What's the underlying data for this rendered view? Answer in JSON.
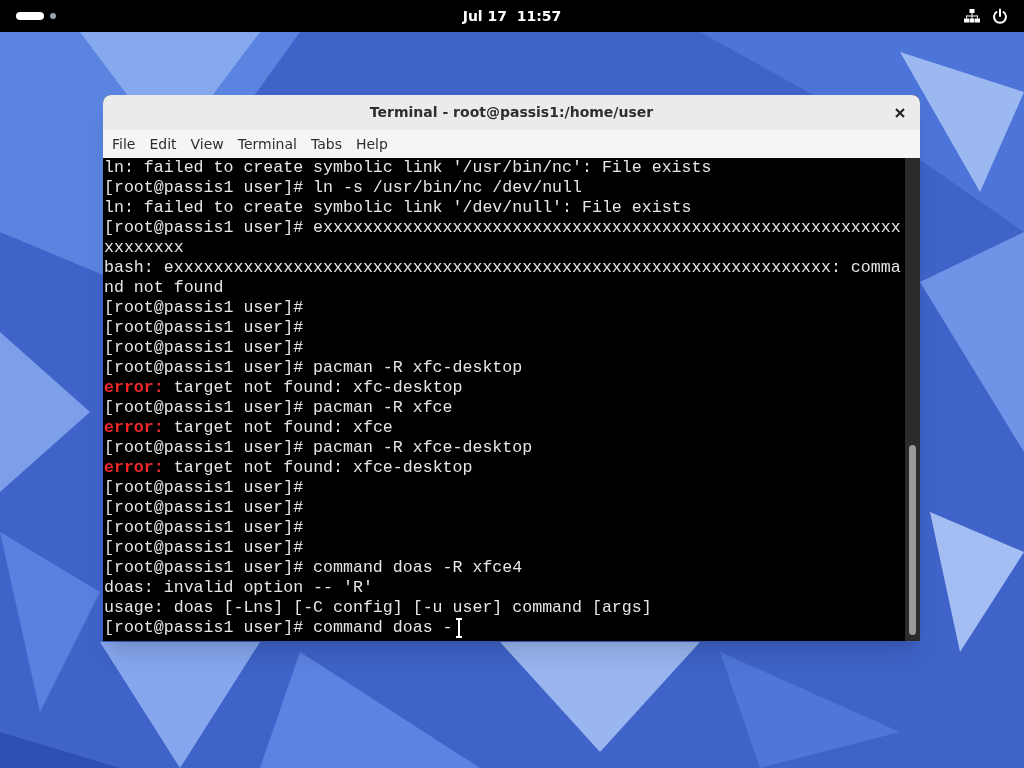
{
  "top_bar": {
    "clock": "Jul 17  11:57"
  },
  "window": {
    "title": "Terminal - root@passis1:/home/user"
  },
  "menu": [
    "File",
    "Edit",
    "View",
    "Terminal",
    "Tabs",
    "Help"
  ],
  "terminal": {
    "lines": [
      {
        "kind": "plain",
        "text": "ln: failed to create symbolic link '/usr/bin/nc': File exists"
      },
      {
        "kind": "plain",
        "text": "[root@passis1 user]# ln -s /usr/bin/nc /dev/null"
      },
      {
        "kind": "plain",
        "text": "ln: failed to create symbolic link '/dev/null': File exists"
      },
      {
        "kind": "plain",
        "text": "[root@passis1 user]# exxxxxxxxxxxxxxxxxxxxxxxxxxxxxxxxxxxxxxxxxxxxxxxxxxxxxxxxxx"
      },
      {
        "kind": "plain",
        "text": "xxxxxxxx"
      },
      {
        "kind": "plain",
        "text": "bash: exxxxxxxxxxxxxxxxxxxxxxxxxxxxxxxxxxxxxxxxxxxxxxxxxxxxxxxxxxxxxxxxxx: comma"
      },
      {
        "kind": "plain",
        "text": "nd not found"
      },
      {
        "kind": "plain",
        "text": "[root@passis1 user]#"
      },
      {
        "kind": "plain",
        "text": "[root@passis1 user]#"
      },
      {
        "kind": "plain",
        "text": "[root@passis1 user]#"
      },
      {
        "kind": "plain",
        "text": "[root@passis1 user]# pacman -R xfc-desktop"
      },
      {
        "kind": "error",
        "label": "error:",
        "text": "target not found: xfc-desktop"
      },
      {
        "kind": "plain",
        "text": "[root@passis1 user]# pacman -R xfce"
      },
      {
        "kind": "error",
        "label": "error:",
        "text": "target not found: xfce"
      },
      {
        "kind": "plain",
        "text": "[root@passis1 user]# pacman -R xfce-desktop"
      },
      {
        "kind": "error",
        "label": "error:",
        "text": "target not found: xfce-desktop"
      },
      {
        "kind": "plain",
        "text": "[root@passis1 user]#"
      },
      {
        "kind": "plain",
        "text": "[root@passis1 user]#"
      },
      {
        "kind": "plain",
        "text": "[root@passis1 user]#"
      },
      {
        "kind": "plain",
        "text": "[root@passis1 user]#"
      },
      {
        "kind": "plain",
        "text": "[root@passis1 user]# command doas -R xfce4"
      },
      {
        "kind": "plain",
        "text": "doas: invalid option -- 'R'"
      },
      {
        "kind": "plain",
        "text": "usage: doas [-Lns] [-C config] [-u user] command [args]"
      },
      {
        "kind": "plain",
        "text": "[root@passis1 user]# command doas -"
      }
    ]
  }
}
